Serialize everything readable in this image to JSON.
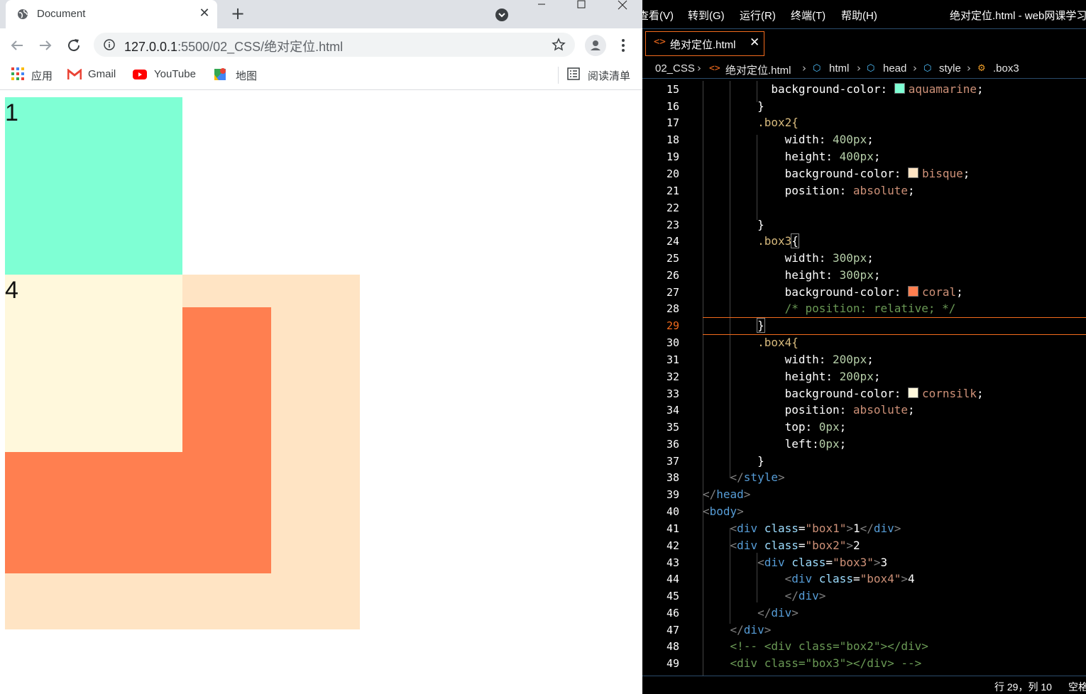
{
  "browser": {
    "tab_title": "Document",
    "tab_close": "✕",
    "new_tab": "+",
    "url_host": "127.0.0.1",
    "url_path": ":5500/02_CSS/绝对定位.html",
    "bookmarks": {
      "apps": "应用",
      "gmail": "Gmail",
      "youtube": "YouTube",
      "maps": "地图",
      "reading_list": "阅读清单"
    },
    "page": {
      "box1_text": "1",
      "box4_text": "4",
      "colors": {
        "box1": "#7fffd4",
        "box2": "#ffe4c4",
        "box3": "#ff7f50",
        "box4": "#fff8dc"
      }
    }
  },
  "editor": {
    "menu": [
      "查看(V)",
      "转到(G)",
      "运行(R)",
      "终端(T)",
      "帮助(H)"
    ],
    "window_title": "绝对定位.html - web网课学习",
    "file_tab": "绝对定位.html",
    "file_tab_close": "✕",
    "breadcrumbs": [
      "02_CSS",
      "绝对定位.html",
      "html",
      "head",
      "style",
      ".box3"
    ],
    "active_line": 29,
    "line_numbers": [
      "15",
      "16",
      "17",
      "18",
      "19",
      "20",
      "21",
      "22",
      "23",
      "24",
      "25",
      "26",
      "27",
      "28",
      "29",
      "30",
      "31",
      "32",
      "33",
      "34",
      "35",
      "36",
      "37",
      "38",
      "39",
      "40",
      "41",
      "42",
      "43",
      "44",
      "45",
      "46",
      "47",
      "48",
      "49"
    ],
    "code": {
      "l15": [
        "background-color",
        "aquamarine"
      ],
      "l17": ".box2{",
      "l18": [
        "width",
        "400px"
      ],
      "l19": [
        "height",
        "400px"
      ],
      "l20": [
        "background-color",
        "bisque"
      ],
      "l21": [
        "position",
        "absolute"
      ],
      "l24": ".box3",
      "l25": [
        "width",
        "300px"
      ],
      "l26": [
        "height",
        "300px"
      ],
      "l27": [
        "background-color",
        "coral"
      ],
      "l28": "/* position: relative; */",
      "l30": ".box4{",
      "l31": [
        "width",
        "200px"
      ],
      "l32": [
        "height",
        "200px"
      ],
      "l33": [
        "background-color",
        "cornsilk"
      ],
      "l34": [
        "position",
        "absolute"
      ],
      "l35": [
        "top",
        "0px"
      ],
      "l36": [
        "left",
        "0px"
      ],
      "l41": [
        "box1",
        "1"
      ],
      "l42": [
        "box2",
        "2"
      ],
      "l43": [
        "box3",
        "3"
      ],
      "l44": [
        "box4",
        "4"
      ],
      "l48": "<!-- <div class=\"box2\"></div>",
      "l49": "<div class=\"box3\"></div> -->"
    },
    "status": {
      "position": "行 29，列 10",
      "indent": "空格"
    }
  }
}
